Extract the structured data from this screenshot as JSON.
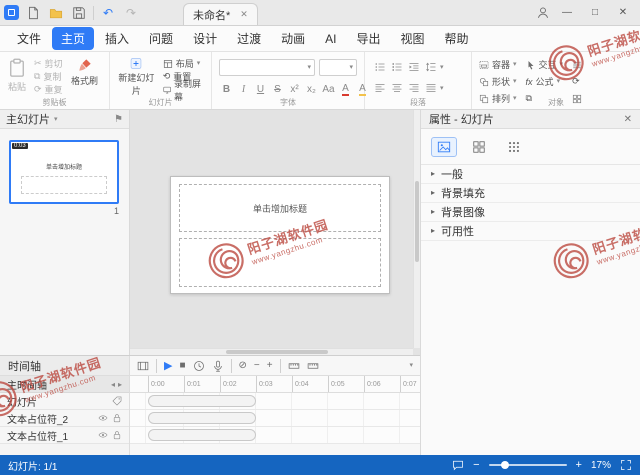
{
  "titlebar": {
    "tab_title": "未命名*"
  },
  "menubar": {
    "items": [
      "文件",
      "主页",
      "插入",
      "问题",
      "设计",
      "过渡",
      "动画",
      "AI",
      "导出",
      "视图",
      "帮助"
    ],
    "active": "主页"
  },
  "ribbon": {
    "clipboard": {
      "label": "剪贴板",
      "paste": "粘贴",
      "cut": "剪切",
      "copy": "复制",
      "repeat": "重复",
      "format_painter": "格式刷"
    },
    "slides": {
      "label": "幻灯片",
      "new_slide": "新建幻灯片",
      "layout": "布局",
      "reset": "重置",
      "record": "录制屏幕"
    },
    "font": {
      "label": "字体",
      "bold": "B",
      "italic": "I",
      "underline": "U",
      "strike": "S",
      "superscript": "x²",
      "subscript": "x₂",
      "case_toggle": "Aa",
      "font_color": "A",
      "highlight": "A"
    },
    "paragraph": {
      "label": "段落"
    },
    "objects": {
      "label": "对象",
      "container": "容器",
      "interaction": "交互",
      "shape": "形状",
      "formula": "公式",
      "arrange": "排列"
    }
  },
  "left_panel": {
    "header": "主幻灯片",
    "thumb_time": "0:03",
    "thumb_title": "单击增加标题",
    "page_number": "1"
  },
  "canvas": {
    "placeholder_title": "单击增加标题"
  },
  "right_panel": {
    "title": "属性 - 幻灯片",
    "sections": [
      "一般",
      "背景填充",
      "背景图像",
      "可用性"
    ]
  },
  "timeline": {
    "panel_title": "时间轴",
    "main_tab": "主时间轴",
    "ruler": [
      "0:00",
      "0:01",
      "0:02",
      "0:03",
      "0:04",
      "0:05",
      "0:06",
      "0:07"
    ],
    "rows": [
      {
        "label": "幻灯片"
      },
      {
        "label": "文本占位符_2"
      },
      {
        "label": "文本占位符_1"
      }
    ]
  },
  "status_bar": {
    "slide_indicator": "幻灯片: 1/1",
    "zoom_level": "17%"
  },
  "watermark": {
    "text": "阳子湖软件园",
    "url": "www.yangzhu.com"
  },
  "icons": {
    "caret_down": "▾",
    "caret_right": "▸",
    "caret_left": "◂",
    "close": "✕",
    "minimize": "—",
    "maximize": "□",
    "undo": "↶",
    "redo": "↷",
    "cut": "✂",
    "copy": "⧉",
    "repeat": "⟳",
    "reset": "⟲",
    "play": "▶",
    "stop": "■",
    "no_entry": "⊘",
    "minus": "−",
    "plus": "+",
    "flag": "⚑",
    "formula": "fx"
  },
  "colors": {
    "accent": "#2f7bf6",
    "statusbar": "#1565c0",
    "watermark": "#bc4a41"
  }
}
